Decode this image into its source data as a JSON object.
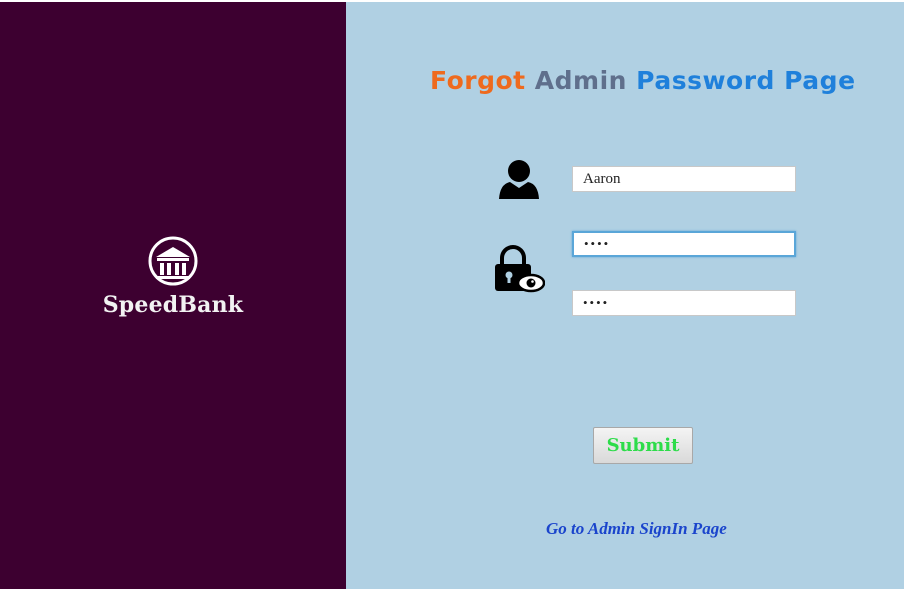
{
  "brand": {
    "name": "SpeedBank",
    "logo_icon": "bank-building-icon"
  },
  "form": {
    "title_part1": "Forgot ",
    "title_part2": "Admin ",
    "title_part3": "Password Page",
    "username_value": "Aaron",
    "password_value": "abcd",
    "confirm_password_value": "abcd",
    "user_icon": "user-icon",
    "lock_icon": "lock-eye-icon",
    "submit_label": "Submit",
    "signin_link_label": "Go to Admin SignIn Page"
  },
  "colors": {
    "sidebar_bg": "#3d0030",
    "main_bg": "#b0d0e3",
    "title_orange": "#ee6a1e",
    "title_steel": "#5f6f8c",
    "title_blue": "#1f80db",
    "submit_text": "#2ddc4a",
    "link_text": "#1a44cc"
  }
}
